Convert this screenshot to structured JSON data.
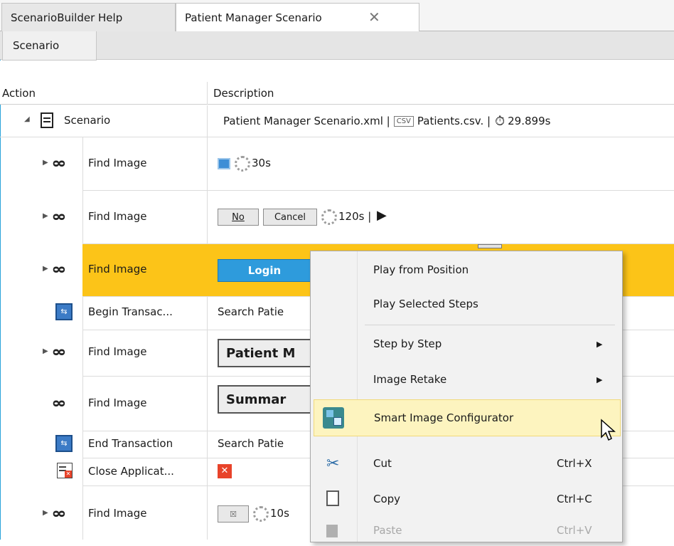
{
  "tabs": {
    "help": "ScenarioBuilder Help",
    "scenario": "Patient Manager Scenario",
    "close": "✕",
    "sub": "Scenario"
  },
  "columns": {
    "action": "Action",
    "description": "Description"
  },
  "root": {
    "action": "Scenario",
    "desc_file": "Patient Manager Scenario.xml |",
    "csv_badge": "CSV",
    "desc_csv": "Patients.csv. |",
    "timer": "29.899s"
  },
  "rows": [
    {
      "action": "Find Image",
      "timeout": "30s"
    },
    {
      "action": "Find Image",
      "btn_no": "No",
      "btn_cancel": "Cancel",
      "timeout": "120s |"
    },
    {
      "action": "Find Image",
      "login": "Login"
    },
    {
      "action": "Begin Transac...",
      "desc": "Search Patie"
    },
    {
      "action": "Find Image",
      "img": "Patient M"
    },
    {
      "action": "Find Image",
      "img": "Summar"
    },
    {
      "action": "End Transaction",
      "desc": "Search Patie"
    },
    {
      "action": "Close Applicat..."
    },
    {
      "action": "Find Image",
      "timeout": "10s"
    }
  ],
  "context_menu": {
    "items": [
      {
        "label": "Play from Position"
      },
      {
        "label": "Play Selected Steps"
      },
      {
        "label": "Step by Step"
      },
      {
        "label": "Image Retake"
      },
      {
        "label": "Smart Image Configurator"
      },
      {
        "label": "Cut",
        "shortcut": "Ctrl+X"
      },
      {
        "label": "Copy",
        "shortcut": "Ctrl+C"
      },
      {
        "label": "Paste",
        "shortcut": "Ctrl+V"
      }
    ]
  },
  "colors": {
    "selected_row": "#fcc418",
    "menu_highlight": "#fdf4bf",
    "login_blue": "#2e9bdc",
    "close_red": "#e8432a",
    "window_border": "#29a3da"
  }
}
